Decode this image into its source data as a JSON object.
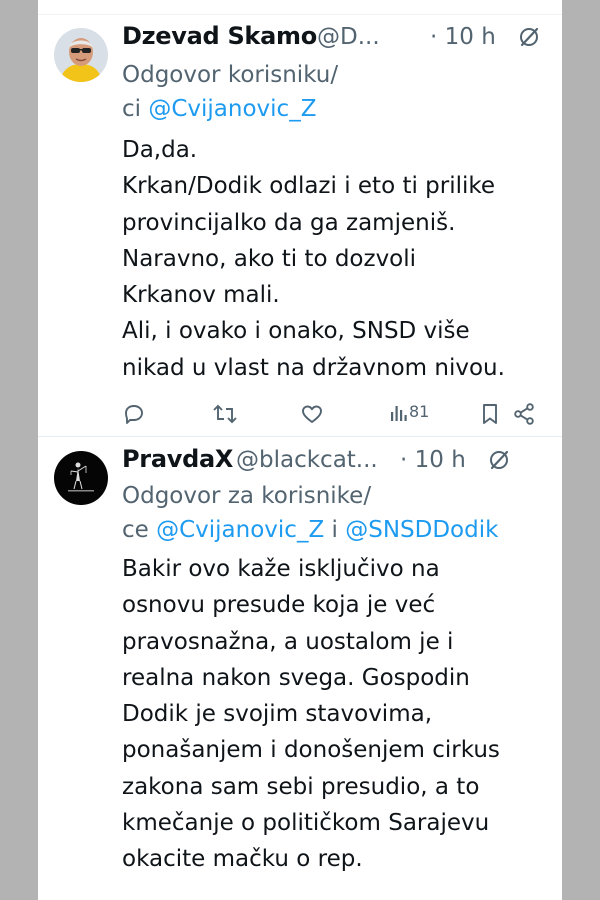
{
  "tweets": [
    {
      "author": "Dzevad Skamo",
      "handle": "@D...",
      "time": "· 10 h",
      "reply_prefix": "Odgovor korisniku/",
      "reply_line2_prefix": "ci ",
      "reply_mentions": [
        "@Cvijanovic_Z"
      ],
      "lines": [
        "Da,da.",
        "Krkan/Dodik odlazi i eto ti prilike",
        "provincijalko da ga zamjeniš.",
        "Naravno, ako ti to dozvoli",
        "Krkanov mali.",
        "Ali, i ovako i onako, SNSD više",
        "nikad u vlast na državnom nivou."
      ],
      "views": "81",
      "avatar_icon": "profile-photo-man-yellow-shirt"
    },
    {
      "author": "PravdaX",
      "handle": "@blackcat...",
      "time": "· 10 h",
      "reply_prefix": "Odgovor za korisnike/",
      "reply_line2_prefix": "ce ",
      "reply_mentions": [
        "@Cvijanovic_Z",
        "@SNSDDodik"
      ],
      "reply_joiner": " i ",
      "lines": [
        "Bakir ovo kaže isključivo na",
        "osnovu presude koja je već",
        "pravosnažna, a uostalom je i",
        "realna nakon svega. Gospodin",
        "Dodik je svojim stavovima,",
        "ponašanjem i donošenjem cirkus",
        "zakona sam sebi presudio, a to",
        "kmečanje o političkom Sarajevu",
        "okacite mačku o rep."
      ],
      "avatar_icon": "lady-justice-logo"
    }
  ],
  "icons": [
    "reply-icon",
    "retweet-icon",
    "like-icon",
    "views-icon",
    "bookmark-icon",
    "share-icon",
    "grok-icon",
    "more-icon"
  ],
  "colors": {
    "text": "#0f1419",
    "secondary": "#536471",
    "link": "#1d9bf0",
    "background": "#ffffff",
    "side": "#b3b3b3"
  }
}
